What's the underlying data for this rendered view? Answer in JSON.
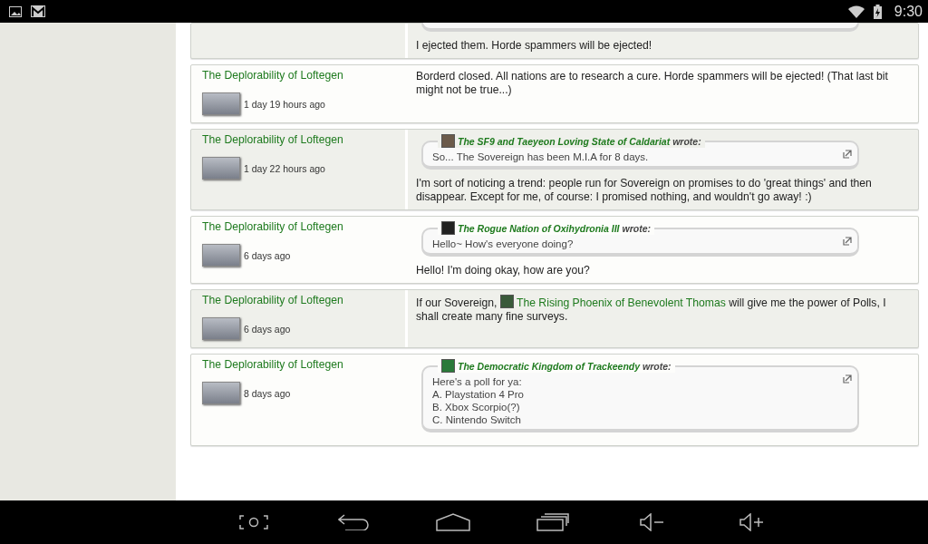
{
  "status_bar": {
    "time": "9:30"
  },
  "posts": [
    {
      "shaded": true,
      "partial_quote": true,
      "body": [
        {
          "kind": "plain",
          "text": "I ejected them. Horde spammers will be ejected!"
        }
      ]
    },
    {
      "shaded": false,
      "author": "The Deplorability of Loftegen",
      "time": "1 day 19 hours ago",
      "body": [
        {
          "kind": "plain",
          "text": "Borderd closed. All nations are to research a cure. Horde spammers will be ejected! (That last bit might not be true...)"
        }
      ]
    },
    {
      "shaded": true,
      "author": "The Deplorability of Loftegen",
      "time": "1 day 22 hours ago",
      "quote": {
        "source": "The SF9 and Taeyeon Loving State of Caldariat",
        "wrote": "wrote:",
        "lines": [
          "So... The Sovereign has been M.I.A for 8 days."
        ]
      },
      "body": [
        {
          "kind": "plain",
          "text": "I'm sort of noticing a trend: people run for Sovereign on promises to do 'great things' and then disappear. Except for me, of course: I promised nothing, and wouldn't go away! :)"
        }
      ]
    },
    {
      "shaded": false,
      "author": "The Deplorability of Loftegen",
      "time": "6 days ago",
      "quote": {
        "source": "The Rogue Nation of Oxihydronia III",
        "wrote": "wrote:",
        "lines": [
          "Hello~ How's everyone doing?"
        ]
      },
      "body": [
        {
          "kind": "plain",
          "text": "Hello! I'm doing okay, how are you?"
        }
      ]
    },
    {
      "shaded": true,
      "author": "The Deplorability of Loftegen",
      "time": "6 days ago",
      "body": [
        {
          "kind": "plain",
          "text": "If our Sovereign, "
        },
        {
          "kind": "link",
          "text": "The Rising Phoenix of Benevolent Thomas"
        },
        {
          "kind": "plain",
          "text": " will give me the power of Polls, I shall create many fine surveys."
        }
      ]
    },
    {
      "shaded": false,
      "author": "The Deplorability of Loftegen",
      "time": "8 days ago",
      "quote": {
        "source": "The Democratic Kingdom of Trackeendy",
        "wrote": "wrote:",
        "lines": [
          "Here's a poll for ya:",
          "A. Playstation 4 Pro",
          "B. Xbox Scorpio(?)",
          "C. Nintendo Switch"
        ]
      }
    }
  ]
}
